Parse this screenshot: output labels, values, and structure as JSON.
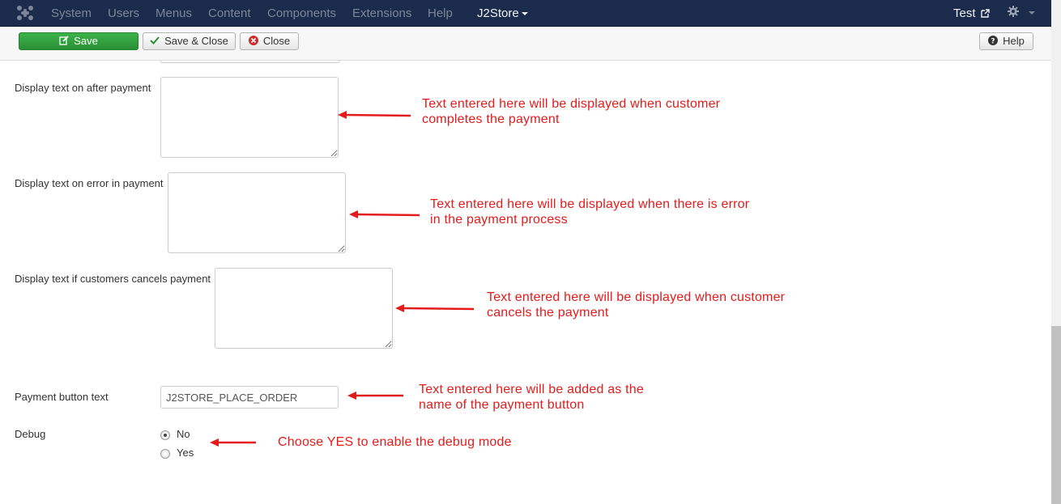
{
  "navbar": {
    "items": [
      "System",
      "Users",
      "Menus",
      "Content",
      "Components",
      "Extensions",
      "Help"
    ],
    "active_menu": "J2Store",
    "user_link": "Test"
  },
  "toolbar": {
    "save_label": "Save",
    "save_close_label": "Save & Close",
    "close_label": "Close",
    "help_label": "Help"
  },
  "form": {
    "after_payment_label": "Display text on after payment",
    "error_payment_label": "Display text on error in payment",
    "cancel_payment_label": "Display text if customers cancels payment",
    "button_text_label": "Payment button text",
    "button_text_value": "J2STORE_PLACE_ORDER",
    "debug_label": "Debug",
    "debug_options": [
      "No",
      "Yes"
    ],
    "debug_selected": "No"
  },
  "annotations": {
    "after_payment": [
      "Text entered here will be displayed when customer",
      "completes the payment"
    ],
    "error_payment": [
      "Text entered here will be displayed when there is error",
      "in the payment process"
    ],
    "cancel_payment": [
      "Text entered here will be displayed when customer",
      "cancels the payment"
    ],
    "button_text": [
      "Text entered here will be added as the",
      "name of the payment button"
    ],
    "debug": [
      "Choose YES to enable the debug mode"
    ]
  },
  "colors": {
    "navbar_bg": "#1a2b4b",
    "save_button": "#2a8f36",
    "annotation": "#e41b1b"
  }
}
